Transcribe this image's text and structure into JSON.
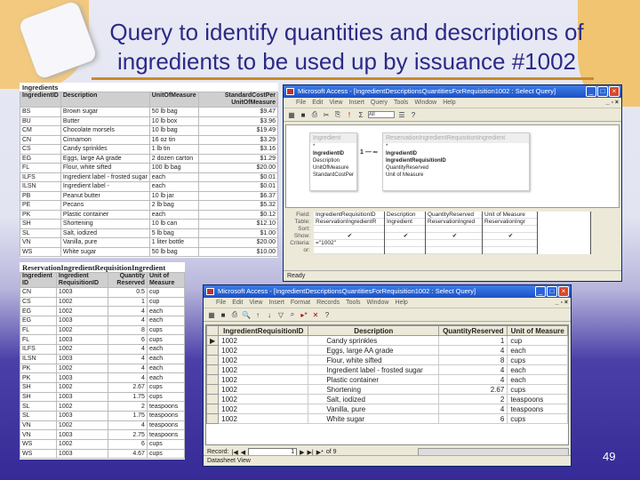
{
  "slide": {
    "title_line1": "Query to identify quantities and descriptions of",
    "title_line2": "ingredients to be used up by issuance #1002",
    "page_number": "49"
  },
  "ingredients": {
    "caption": "Ingredients",
    "headers": [
      "IngredientID",
      "Description",
      "UnitOfMeasure",
      "StandardCostPer UnitOfMeasure"
    ],
    "rows": [
      [
        "BS",
        "Brown sugar",
        "50 lb bag",
        "$9.47"
      ],
      [
        "BU",
        "Butter",
        "10 lb box",
        "$3.96"
      ],
      [
        "CM",
        "Chocolate morsels",
        "10 lb bag",
        "$19.49"
      ],
      [
        "CN",
        "Cinnamon",
        "16 oz tin",
        "$3.29"
      ],
      [
        "CS",
        "Candy sprinkles",
        "1 lb tin",
        "$3.16"
      ],
      [
        "EG",
        "Eggs, large AA grade",
        "2 dozen carton",
        "$1.29"
      ],
      [
        "FL",
        "Flour, white sifted",
        "100 lb bag",
        "$20.00"
      ],
      [
        "ILFS",
        "Ingredient label - frosted sugar",
        "each",
        "$0.01"
      ],
      [
        "ILSN",
        "Ingredient label -",
        "each",
        "$0.01"
      ],
      [
        "PB",
        "Peanut butter",
        "10 lb jar",
        "$6.37"
      ],
      [
        "PE",
        "Pecans",
        "2 lb bag",
        "$5.32"
      ],
      [
        "PK",
        "Plastic container",
        "each",
        "$0.12"
      ],
      [
        "SH",
        "Shortening",
        "10 lb can",
        "$12.10"
      ],
      [
        "SL",
        "Salt, iodized",
        "5 lb bag",
        "$1.00"
      ],
      [
        "VN",
        "Vanilla, pure",
        "1 liter bottle",
        "$20.00"
      ],
      [
        "WS",
        "White sugar",
        "50 lb bag",
        "$10.00"
      ]
    ]
  },
  "reservation": {
    "caption": "ReservationIngredientRequisitionIngredient",
    "headers": [
      "Ingredient ID",
      "Ingredient RequisitionID",
      "Quantity Reserved",
      "Unit of Measure"
    ],
    "rows": [
      [
        "CN",
        "1003",
        "0.5",
        "cup"
      ],
      [
        "CS",
        "1002",
        "1",
        "cup"
      ],
      [
        "EG",
        "1002",
        "4",
        "each"
      ],
      [
        "EG",
        "1003",
        "4",
        "each"
      ],
      [
        "FL",
        "1002",
        "8",
        "cups"
      ],
      [
        "FL",
        "1003",
        "6",
        "cups"
      ],
      [
        "ILFS",
        "1002",
        "4",
        "each"
      ],
      [
        "ILSN",
        "1003",
        "4",
        "each"
      ],
      [
        "PK",
        "1002",
        "4",
        "each"
      ],
      [
        "PK",
        "1003",
        "4",
        "each"
      ],
      [
        "SH",
        "1002",
        "2.67",
        "cups"
      ],
      [
        "SH",
        "1003",
        "1.75",
        "cups"
      ],
      [
        "SL",
        "1002",
        "2",
        "teaspoons"
      ],
      [
        "SL",
        "1003",
        "1.75",
        "teaspoons"
      ],
      [
        "VN",
        "1002",
        "4",
        "teaspoons"
      ],
      [
        "VN",
        "1003",
        "2.75",
        "teaspoons"
      ],
      [
        "WS",
        "1002",
        "6",
        "cups"
      ],
      [
        "WS",
        "1003",
        "4.67",
        "cups"
      ]
    ]
  },
  "design_window": {
    "title": "Microsoft Access - [IngredientDescriptionsQuantitiesForRequisition1002 : Select Query]",
    "menu": [
      "File",
      "Edit",
      "View",
      "Insert",
      "Query",
      "Tools",
      "Window",
      "Help"
    ],
    "top_values": "All",
    "table1": {
      "name": "Ingredient",
      "fields": [
        "*",
        "IngredientID",
        "Description",
        "UnitOfMeasure",
        "StandardCostPer"
      ]
    },
    "table2": {
      "name": "ReservationIngredientRequisitionIngredient",
      "fields": [
        "*",
        "IngredientID",
        "IngredientRequisitionID",
        "QuantityReserved",
        "Unit of Measure"
      ]
    },
    "join": {
      "one": "1",
      "many": "∞"
    },
    "row_labels": [
      "Field:",
      "Table:",
      "Sort:",
      "Show:",
      "Criteria:",
      "or:"
    ],
    "columns": [
      {
        "field": "IngredientRequisitionID",
        "table": "ReservationIngredientR",
        "show": "✔",
        "criteria": "=\"1002\""
      },
      {
        "field": "Description",
        "table": "Ingredient",
        "show": "✔",
        "criteria": ""
      },
      {
        "field": "QuantityReserved",
        "table": "ReservationIngred",
        "show": "✔",
        "criteria": ""
      },
      {
        "field": "Unit of Measure",
        "table": "ReservationIngr",
        "show": "✔",
        "criteria": ""
      }
    ],
    "status": "Ready"
  },
  "datasheet_window": {
    "title": "Microsoft Access - [IngredientDescriptionsQuantitiesForRequisition1002 : Select Query]",
    "menu": [
      "File",
      "Edit",
      "View",
      "Insert",
      "Format",
      "Records",
      "Tools",
      "Window",
      "Help"
    ],
    "headers": [
      "IngredientRequisitionID",
      "Description",
      "QuantityReserved",
      "Unit of Measure"
    ],
    "rows": [
      [
        "1002",
        "Candy sprinkles",
        "1",
        "cup"
      ],
      [
        "1002",
        "Eggs, large AA grade",
        "4",
        "each"
      ],
      [
        "1002",
        "Flour, white sifted",
        "8",
        "cups"
      ],
      [
        "1002",
        "Ingredient label - frosted sugar",
        "4",
        "each"
      ],
      [
        "1002",
        "Plastic container",
        "4",
        "each"
      ],
      [
        "1002",
        "Shortening",
        "2.67",
        "cups"
      ],
      [
        "1002",
        "Salt, iodized",
        "2",
        "teaspoons"
      ],
      [
        "1002",
        "Vanilla, pure",
        "4",
        "teaspoons"
      ],
      [
        "1002",
        "White sugar",
        "6",
        "cups"
      ]
    ],
    "record_label": "Record:",
    "current_record": "1",
    "record_total": "of 9",
    "status": "Datasheet View"
  }
}
